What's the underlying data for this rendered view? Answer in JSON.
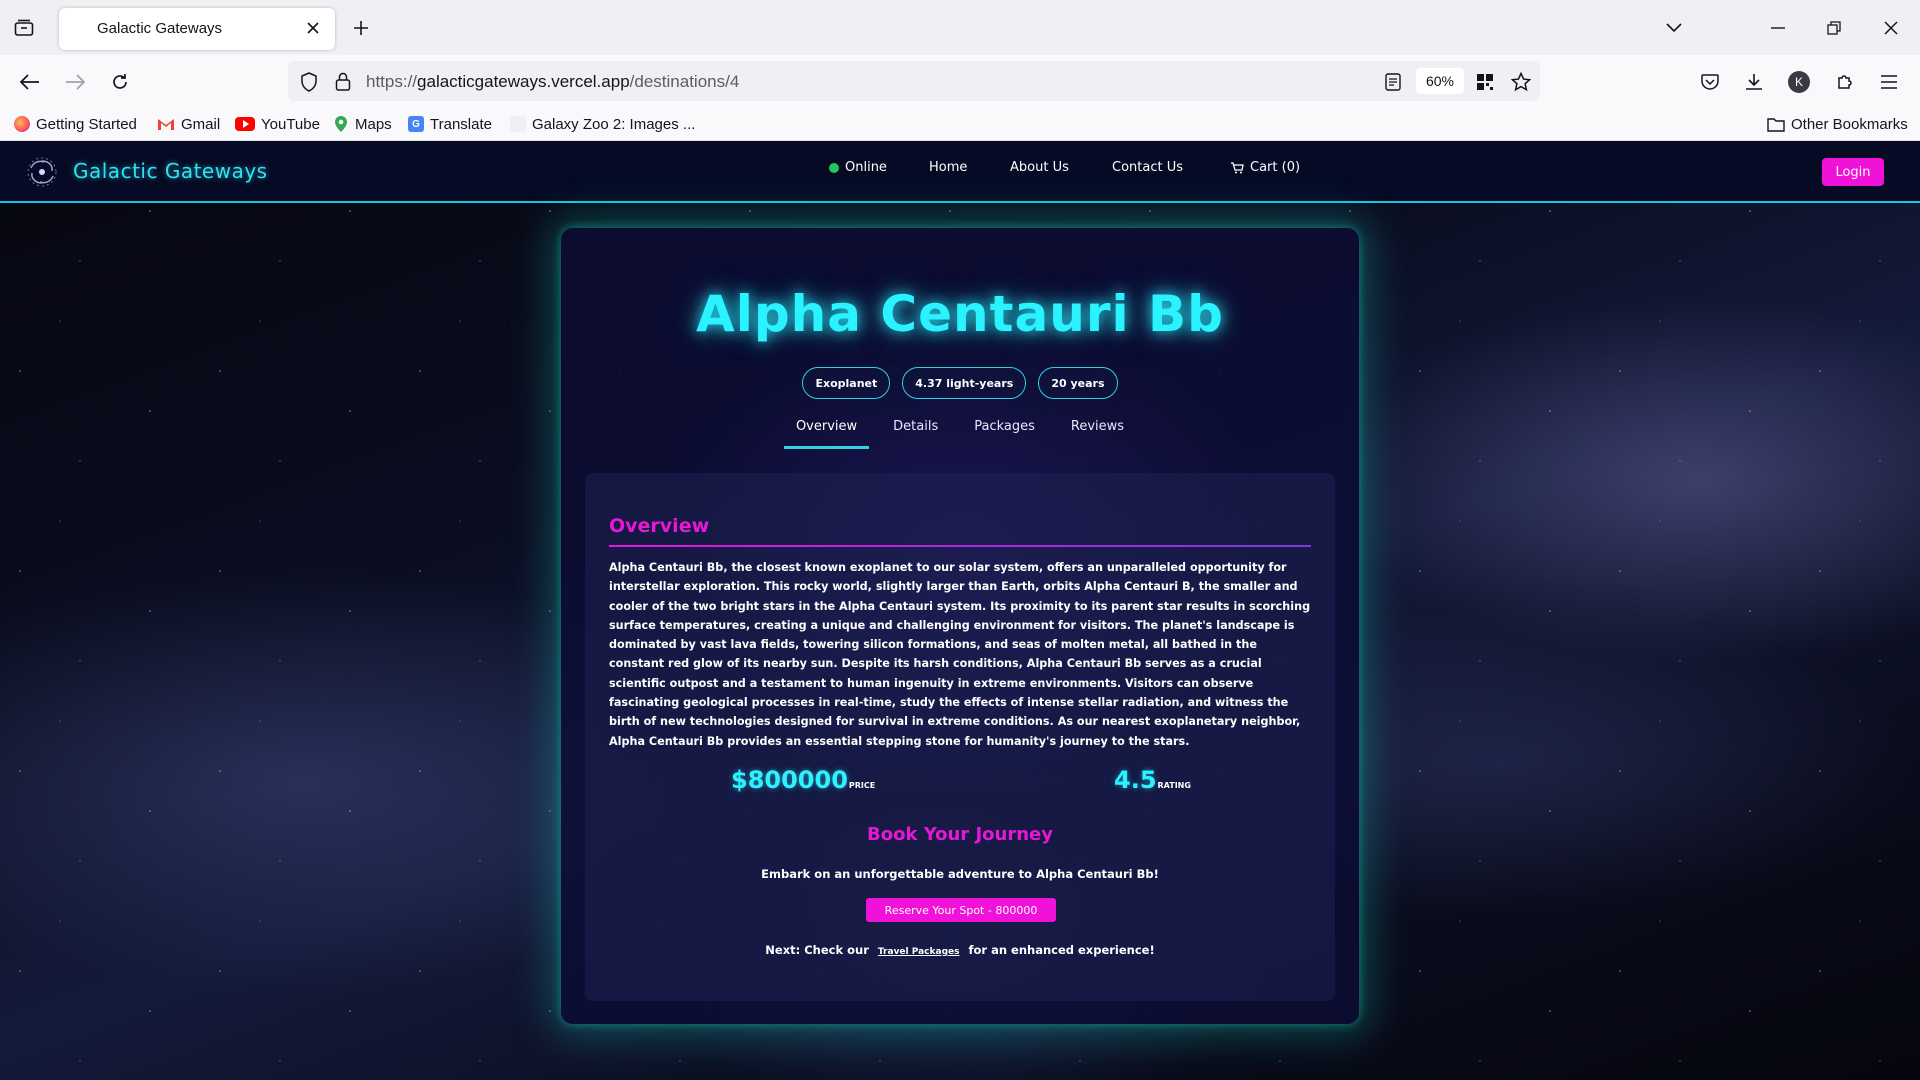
{
  "browser": {
    "tab_title": "Galactic Gateways",
    "url_prefix": "https://",
    "url_host": "galacticgateways.vercel.app",
    "url_path": "/destinations/4",
    "zoom": "60%",
    "bookmarks": [
      "Getting Started",
      "Gmail",
      "YouTube",
      "Maps",
      "Translate",
      "Galaxy Zoo 2: Images ..."
    ],
    "other_bookmarks": "Other Bookmarks",
    "profile_initial": "K"
  },
  "site": {
    "brand": "Galactic Gateways",
    "nav": {
      "online": "Online",
      "home": "Home",
      "about": "About Us",
      "contact": "Contact Us",
      "cart": "Cart (0)"
    },
    "login": "Login"
  },
  "destination": {
    "name": "Alpha Centauri Bb",
    "chips": [
      "Exoplanet",
      "4.37 light-years",
      "20 years"
    ],
    "tabs": [
      "Overview",
      "Details",
      "Packages",
      "Reviews"
    ],
    "active_tab": "Overview",
    "section_title": "Overview",
    "description": "Alpha Centauri Bb, the closest known exoplanet to our solar system, offers an unparalleled opportunity for interstellar exploration. This rocky world, slightly larger than Earth, orbits Alpha Centauri B, the smaller and cooler of the two bright stars in the Alpha Centauri system. Its proximity to its parent star results in scorching surface temperatures, creating a unique and challenging environment for visitors. The planet's landscape is dominated by vast lava fields, towering silicon formations, and seas of molten metal, all bathed in the constant red glow of its nearby sun. Despite its harsh conditions, Alpha Centauri Bb serves as a crucial scientific outpost and a testament to human ingenuity in extreme environments. Visitors can observe fascinating geological processes in real-time, study the effects of intense stellar radiation, and witness the birth of new technologies designed for survival in extreme conditions. As our nearest exoplanetary neighbor, Alpha Centauri Bb provides an essential stepping stone for humanity's journey to the stars.",
    "price_value": "$800000",
    "price_label": "PRICE",
    "rating_value": "4.5",
    "rating_label": "RATING",
    "book_title": "Book Your Journey",
    "book_sub": "Embark on an unforgettable adventure to Alpha Centauri Bb!",
    "reserve_button": "Reserve Your Spot - 800000",
    "next_prefix": "Next: Check our",
    "next_link": "Travel Packages",
    "next_suffix": "for an enhanced experience!"
  },
  "colors": {
    "accent_cyan": "#2af3ff",
    "accent_magenta": "#f012d8",
    "header_bg": "#060a24",
    "online_green": "#22c55e"
  }
}
